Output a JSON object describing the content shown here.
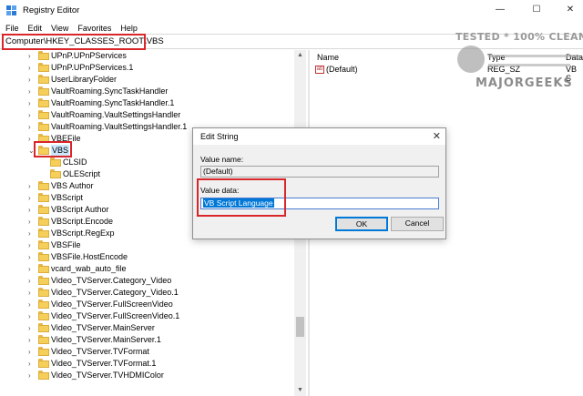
{
  "window": {
    "title": "Registry Editor",
    "minimize": "—",
    "maximize": "☐",
    "close": "✕"
  },
  "menu": [
    "File",
    "Edit",
    "View",
    "Favorites",
    "Help"
  ],
  "address": {
    "path": "Computer\\HKEY_CLASSES_ROOT\\VBS"
  },
  "tree": {
    "items": [
      {
        "label": "UPnP.UPnPServices",
        "indent": 0,
        "expander": "›"
      },
      {
        "label": "UPnP.UPnPServices.1",
        "indent": 0,
        "expander": "›"
      },
      {
        "label": "UserLibraryFolder",
        "indent": 0,
        "expander": "›"
      },
      {
        "label": "VaultRoaming.SyncTaskHandler",
        "indent": 0,
        "expander": "›"
      },
      {
        "label": "VaultRoaming.SyncTaskHandler.1",
        "indent": 0,
        "expander": "›"
      },
      {
        "label": "VaultRoaming.VaultSettingsHandler",
        "indent": 0,
        "expander": "›"
      },
      {
        "label": "VaultRoaming.VaultSettingsHandler.1",
        "indent": 0,
        "expander": "›"
      },
      {
        "label": "VBEFile",
        "indent": 0,
        "expander": "›"
      },
      {
        "label": "VBS",
        "indent": 0,
        "expander": "⌄",
        "selected": true
      },
      {
        "label": "CLSID",
        "indent": 1,
        "expander": ""
      },
      {
        "label": "OLEScript",
        "indent": 1,
        "expander": ""
      },
      {
        "label": "VBS Author",
        "indent": 0,
        "expander": "›"
      },
      {
        "label": "VBScript",
        "indent": 0,
        "expander": "›"
      },
      {
        "label": "VBScript Author",
        "indent": 0,
        "expander": "›"
      },
      {
        "label": "VBScript.Encode",
        "indent": 0,
        "expander": "›"
      },
      {
        "label": "VBScript.RegExp",
        "indent": 0,
        "expander": "›"
      },
      {
        "label": "VBSFile",
        "indent": 0,
        "expander": "›"
      },
      {
        "label": "VBSFile.HostEncode",
        "indent": 0,
        "expander": "›"
      },
      {
        "label": "vcard_wab_auto_file",
        "indent": 0,
        "expander": "›"
      },
      {
        "label": "Video_TVServer.Category_Video",
        "indent": 0,
        "expander": "›"
      },
      {
        "label": "Video_TVServer.Category_Video.1",
        "indent": 0,
        "expander": "›"
      },
      {
        "label": "Video_TVServer.FullScreenVideo",
        "indent": 0,
        "expander": "›"
      },
      {
        "label": "Video_TVServer.FullScreenVideo.1",
        "indent": 0,
        "expander": "›"
      },
      {
        "label": "Video_TVServer.MainServer",
        "indent": 0,
        "expander": "›"
      },
      {
        "label": "Video_TVServer.MainServer.1",
        "indent": 0,
        "expander": "›"
      },
      {
        "label": "Video_TVServer.TVFormat",
        "indent": 0,
        "expander": "›"
      },
      {
        "label": "Video_TVServer.TVFormat.1",
        "indent": 0,
        "expander": "›"
      },
      {
        "label": "Video_TVServer.TVHDMIColor",
        "indent": 0,
        "expander": "›"
      }
    ]
  },
  "values_pane": {
    "columns": [
      "Name",
      "Type",
      "Data"
    ],
    "rows": [
      {
        "icon": "ab",
        "name": "(Default)",
        "type": "REG_SZ",
        "data": "VB S"
      }
    ]
  },
  "watermark": {
    "top_text": "TESTED * 100% CLEAN",
    "brand": "MAJORGEEKS"
  },
  "dialog": {
    "title": "Edit String",
    "close": "✕",
    "value_name_label": "Value name:",
    "value_name": "(Default)",
    "value_data_label": "Value data:",
    "value_data": "VB Script Language",
    "ok_label": "OK",
    "cancel_label": "Cancel"
  },
  "colors": {
    "highlight": "#d9262b",
    "selection": "#0078d7",
    "tree_selected": "#cce8ff",
    "folder": "#f5cf5a"
  }
}
